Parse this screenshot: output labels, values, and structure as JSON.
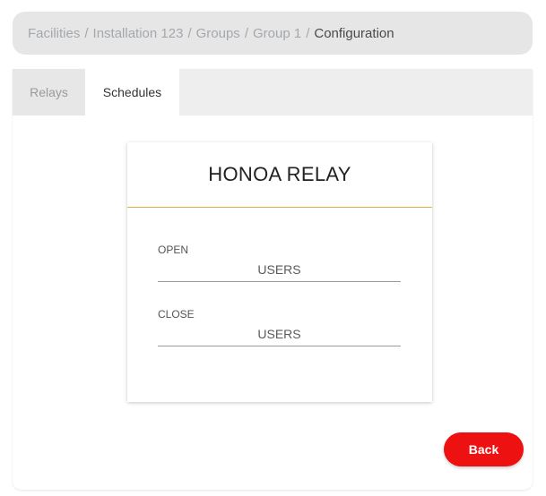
{
  "breadcrumb": {
    "items": [
      "Facilities",
      "Installation 123",
      "Groups",
      "Group 1"
    ],
    "separator": "/",
    "current": "Configuration"
  },
  "tabs": [
    {
      "label": "Relays",
      "active": false
    },
    {
      "label": "Schedules",
      "active": true
    }
  ],
  "card": {
    "title": "HONOA RELAY",
    "fields": [
      {
        "label": "OPEN",
        "value": "USERS"
      },
      {
        "label": "CLOSE",
        "value": "USERS"
      }
    ]
  },
  "actions": {
    "back_label": "Back"
  },
  "colors": {
    "accent_line": "#e0b23c",
    "back_button": "#ee1111",
    "breadcrumb_bg": "#e6e6e6"
  }
}
